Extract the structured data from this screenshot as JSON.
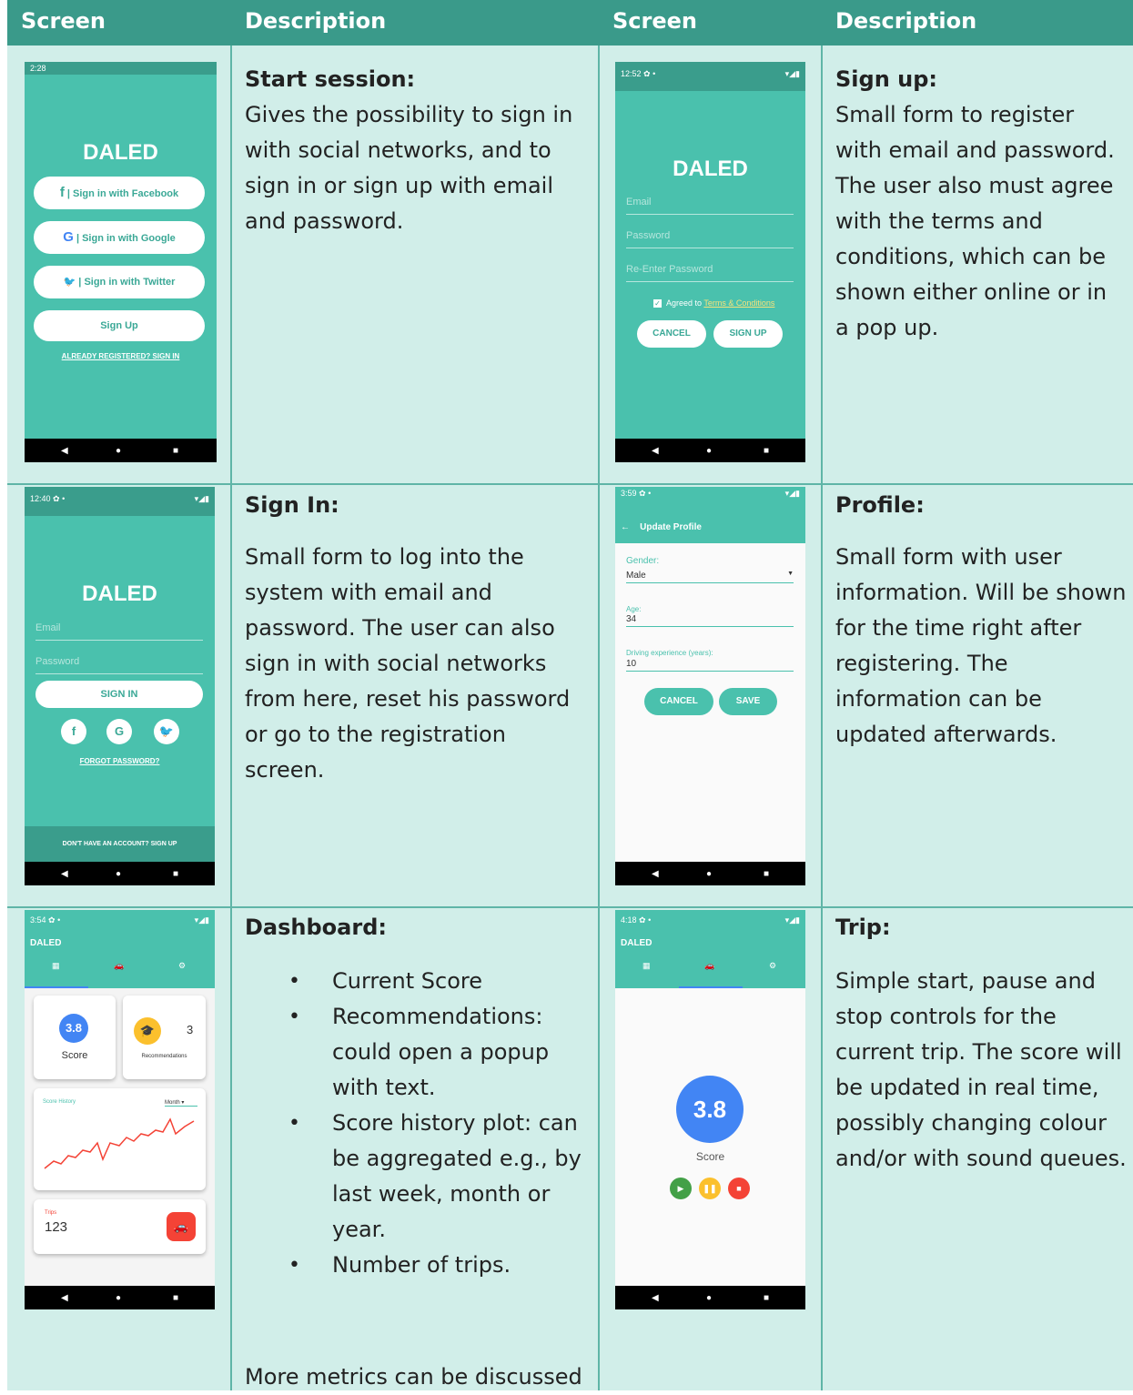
{
  "header": {
    "col1": "Screen",
    "col2": "Description",
    "col3": "Screen",
    "col4": "Description"
  },
  "rows": {
    "r1c1": {
      "title": "Start session:",
      "body": "Gives the possibility to sign in with social networks, and to sign in or sign up with email and password."
    },
    "r1c2": {
      "title": "Sign up:",
      "body": "Small form to register with email and password. The user also must agree with the terms and conditions, which can be shown either online or in a pop up."
    },
    "r2c1": {
      "title": "Sign In:",
      "body": "Small form to log into the system with email and password. The user can also sign in with social networks from here, reset his password or go to the registration screen."
    },
    "r2c2": {
      "title": "Profile:",
      "body": "Small form with user information. Will be shown for the time right after registering. The information can be updated afterwards."
    },
    "r3c1": {
      "title": "Dashboard:",
      "bullets": [
        "Current Score",
        "Recommendations: could open a popup with text.",
        "Score history plot: can be aggregated e.g., by last week, month or year.",
        "Number of trips."
      ],
      "footer": "More metrics can be discussed"
    },
    "r3c2": {
      "title": "Trip:",
      "body": "Simple start, pause and stop controls for the current trip. The score will be updated in real time, possibly changing colour and/or with sound queues."
    }
  },
  "screens": {
    "start": {
      "time": "2:28",
      "logo": "DALED",
      "fb": "Sign in with Facebook",
      "google": "Sign in with Google",
      "twitter": "Sign in with Twitter",
      "signup": "Sign Up",
      "link": "ALREADY REGISTERED? SIGN IN"
    },
    "signup": {
      "time": "12:52",
      "logo": "DALED",
      "email": "Email",
      "password": "Password",
      "reenter": "Re-Enter Password",
      "agree": "Agreed to",
      "terms": "Terms & Conditions",
      "cancel": "CANCEL",
      "submit": "SIGN UP"
    },
    "signin": {
      "time": "12:40",
      "logo": "DALED",
      "email": "Email",
      "password": "Password",
      "submit": "SIGN IN",
      "f": "f",
      "g": "G",
      "t": "t",
      "forgot": "FORGOT PASSWORD?",
      "footer": "DON'T HAVE AN ACCOUNT? SIGN UP"
    },
    "profile": {
      "time": "3:59",
      "title": "Update Profile",
      "gender_label": "Gender:",
      "gender": "Male",
      "age_label": "Age:",
      "age": "34",
      "exp_label": "Driving experience (years):",
      "exp": "10",
      "cancel": "CANCEL",
      "save": "SAVE"
    },
    "dashboard": {
      "time": "3:54",
      "app": "DALED",
      "score": "3.8",
      "score_label": "Score",
      "rec_count": "3",
      "rec_label": "Recommendations",
      "history": "Score History",
      "period": "Month",
      "trips_label": "Trips",
      "trips": "123"
    },
    "trip": {
      "time": "4:18",
      "app": "DALED",
      "score": "3.8",
      "score_label": "Score"
    }
  },
  "colors": {
    "header": "#3a9a8a",
    "cell": "#d1eee9",
    "phone": "#4ac1ad",
    "accent_red": "#f44336",
    "accent_blue": "#4285f4",
    "accent_yellow": "#fbc02d",
    "accent_green": "#43a047"
  }
}
